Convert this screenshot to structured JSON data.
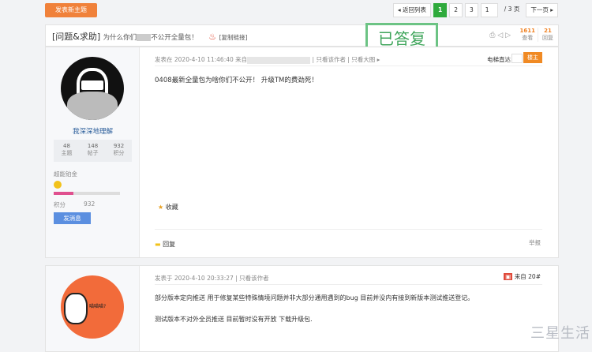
{
  "toolbar": {
    "new_topic": "发表新主题"
  },
  "pager": {
    "back": "◂ 返回列表",
    "pages": [
      "1",
      "2",
      "3"
    ],
    "input": "1",
    "total": "/ 3 页",
    "next": "下一页 ▸"
  },
  "thread": {
    "tag": "[问题&求助]",
    "title_a": "为什么你们",
    "title_b": "不公开全量包！",
    "copy_link": "[复制链接]",
    "stamp": "已答复",
    "views": "1611",
    "views_label": "查看",
    "replies": "21",
    "replies_label": "回复"
  },
  "post1": {
    "meta": "发表在 2020-4-10 11:46:40 来自",
    "only_author": "只看该作者",
    "only_image": "只看大图 ▸",
    "elevator": "电梯直达",
    "owner_badge": "楼主",
    "body": "0408最新全量包为啥你们不公开！ 升级TM的费劲死！",
    "favorite": "收藏",
    "reply": "回复",
    "report": "举报"
  },
  "user1": {
    "name": "我深深地理解",
    "topics": "48",
    "topics_label": "主题",
    "posts": "148",
    "posts_label": "帖子",
    "points": "932",
    "points_label": "积分",
    "level": "超能铂金",
    "points_row_label": "积分",
    "points_row_value": "932",
    "message": "发消息",
    "level_progress": 0.3
  },
  "post2": {
    "meta": "发表于 2020-4-10 20:33:27",
    "only_author": "只看该作者",
    "source": "来自 20#",
    "line1": "部分版本定向推送 用于修复某些特殊情境问题并非大部分通用遇到的bug  目前并没内有接到新版本测试推送登记。",
    "line2": "测试版本不对外全员推送  目前暂时没有开放  下载升级包.",
    "avatar_text": "喵喵喵?"
  },
  "watermark": "三星生活"
}
